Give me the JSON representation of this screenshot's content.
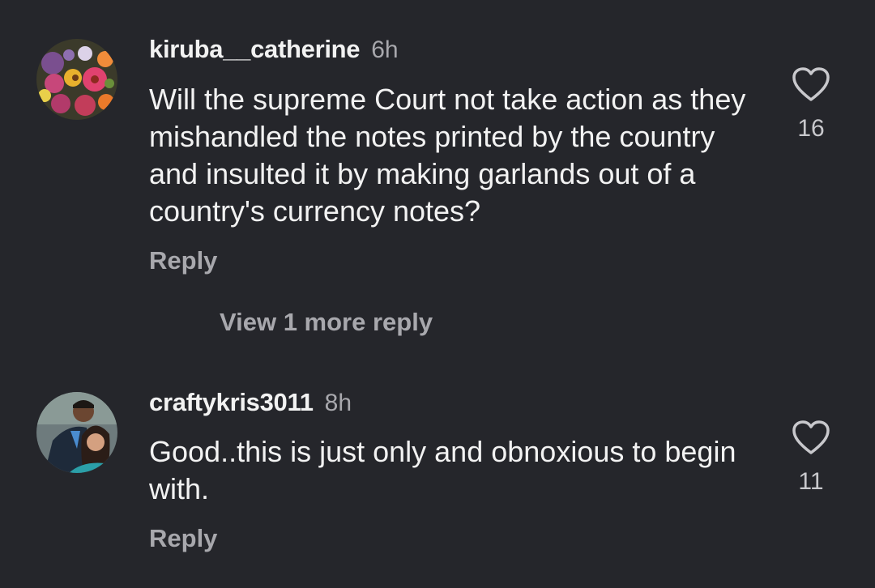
{
  "comments": [
    {
      "username": "kiruba__catherine",
      "time": "6h",
      "text": "Will the supreme Court not take action as they mishandled the notes printed by the country and insulted it by making garlands out of a country's currency notes?",
      "reply_label": "Reply",
      "likes": "16"
    },
    {
      "username": "craftykris3011",
      "time": "8h",
      "text": "Good..this is just only and obnoxious to begin with.",
      "reply_label": "Reply",
      "likes": "11"
    }
  ],
  "view_more_label": "View 1 more reply",
  "colors": {
    "background": "#25262b",
    "primary_text": "#f2f2f2",
    "secondary_text": "#a8a8ad"
  },
  "icons": {
    "like": "heart-outline-icon"
  }
}
